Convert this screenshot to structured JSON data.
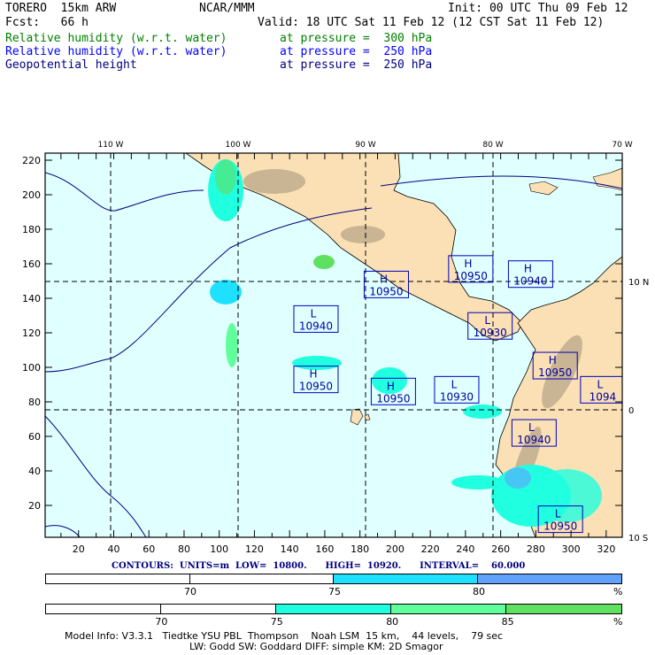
{
  "header": {
    "model": "TORERO  15km ARW",
    "center": "NCAR/MMM",
    "init": "Init: 00 UTC Thu 09 Feb 12",
    "fcst": "Fcst:   66 h",
    "valid": "Valid: 18 UTC Sat 11 Feb 12 (12 CST Sat 11 Feb 12)",
    "fields": [
      {
        "name": "Relative humidity (w.r.t. water)",
        "level": "at pressure =  300 hPa",
        "color": "#008000"
      },
      {
        "name": "Relative humidity (w.r.t. water)",
        "level": "at pressure =  250 hPa",
        "color": "#0000ff"
      },
      {
        "name": "Geopotential height",
        "level": "at pressure =  250 hPa",
        "color": "#000080"
      }
    ]
  },
  "map": {
    "lon_labels": [
      "110 W",
      "100 W",
      "90 W",
      "80 W",
      "70 W"
    ],
    "lat_labels": [
      "10 N",
      "0",
      "10 S"
    ],
    "x_ticks": [
      "20",
      "40",
      "60",
      "80",
      "100",
      "120",
      "140",
      "160",
      "180",
      "200",
      "220",
      "240",
      "260",
      "280",
      "300",
      "320"
    ],
    "y_ticks": [
      "20",
      "40",
      "60",
      "80",
      "100",
      "120",
      "140",
      "160",
      "180",
      "200",
      "220"
    ],
    "colors": {
      "ocean": "#e0ffff",
      "land": "#fae0b4",
      "contour": "#000080"
    },
    "centers": [
      {
        "type": "H",
        "value": "10950",
        "x": 195,
        "y": 148
      },
      {
        "type": "L",
        "value": "10940",
        "x": 155,
        "y": 128
      },
      {
        "type": "H",
        "value": "10950",
        "x": 155,
        "y": 93
      },
      {
        "type": "H",
        "value": "10950",
        "x": 199,
        "y": 86
      },
      {
        "type": "L",
        "value": "10930",
        "x": 235,
        "y": 87
      },
      {
        "type": "H",
        "value": "10950",
        "x": 243,
        "y": 157
      },
      {
        "type": "H",
        "value": "10940",
        "x": 277,
        "y": 154
      },
      {
        "type": "L",
        "value": "10930",
        "x": 254,
        "y": 124
      },
      {
        "type": "H",
        "value": "10950",
        "x": 291,
        "y": 101
      },
      {
        "type": "L",
        "value": "1094",
        "x": 318,
        "y": 87
      },
      {
        "type": "L",
        "value": "10940",
        "x": 279,
        "y": 62
      },
      {
        "type": "L",
        "value": "10950",
        "x": 294,
        "y": 12
      }
    ]
  },
  "contours_line": "CONTOURS:  UNITS=m  LOW=  10800.      HIGH=  10920.      INTERVAL=    60.000",
  "colorbar_250": {
    "labels": [
      "70",
      "75",
      "80",
      "%"
    ],
    "colors": [
      "#ffffff",
      "#ffffff",
      "#20e0ff",
      "#60a0ff"
    ]
  },
  "colorbar_300": {
    "labels": [
      "70",
      "75",
      "80",
      "85",
      "%"
    ],
    "colors": [
      "#ffffff",
      "#ffffff",
      "#20ffe0",
      "#60ff9c",
      "#60e060"
    ]
  },
  "model_info": {
    "line1": "Model Info: V3.3.1   Tiedtke YSU PBL  Thompson    Noah LSM  15 km,    44 levels,    79 sec",
    "line2": "LW: Godd SW: Goddard DIFF: simple KM: 2D Smagor"
  }
}
